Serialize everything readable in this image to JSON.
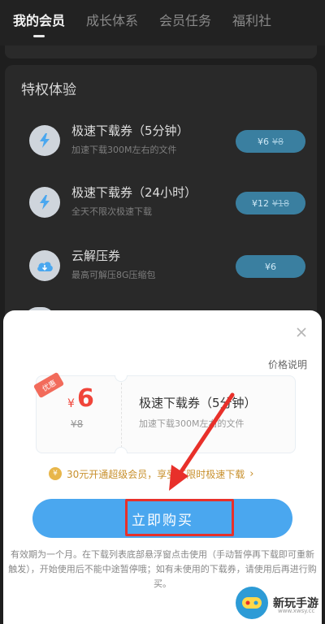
{
  "tabs": [
    {
      "label": "我的会员",
      "active": true
    },
    {
      "label": "成长体系"
    },
    {
      "label": "会员任务"
    },
    {
      "label": "福利社"
    }
  ],
  "privileges": {
    "title": "特权体验",
    "items": [
      {
        "name": "极速下载券（5分钟）",
        "desc": "加速下载300M左右的文件",
        "price": "¥6",
        "old_price": "¥8",
        "icon": "lightning-icon"
      },
      {
        "name": "极速下载券（24小时）",
        "desc": "全天不限次极速下载",
        "price": "¥12",
        "old_price": "¥18",
        "icon": "lightning-icon"
      },
      {
        "name": "云解压券",
        "desc": "最高可解压8G压缩包",
        "price": "¥6",
        "icon": "cloud-icon"
      }
    ]
  },
  "sheet": {
    "price_note": "价格说明",
    "badge": "优惠",
    "currency": "¥",
    "price": "6",
    "old_price": "¥8",
    "ticket_name": "极速下载券（5分钟）",
    "ticket_desc": "加速下载300M左右的文件",
    "promo": "30元开通超级会员，享受不限时极速下载",
    "buy_label": "立即购买",
    "terms": "有效期为一个月。在下载列表底部悬浮窗点击使用（手动暂停再下载即可重新触发），开始使用后不能中途暂停哦；如有未使用的下载券，请使用后再进行购买。"
  },
  "watermark": {
    "text": "新玩手游",
    "sub": "www.xwsy.cc"
  },
  "colors": {
    "accent": "#4aa7ef",
    "price_red": "#f0453a",
    "highlight_frame": "#e8302a",
    "promo": "#c8902d"
  }
}
